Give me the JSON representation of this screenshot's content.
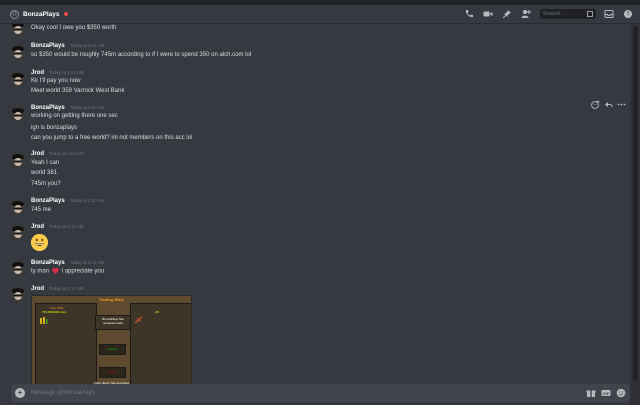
{
  "header": {
    "at_symbol": "@",
    "channel_name": "BonzaPlays",
    "search_placeholder": "Search"
  },
  "messages": [
    {
      "author": "",
      "time": "",
      "lines": [
        "Okay cool I owe you $350 worth"
      ]
    },
    {
      "author": "BonzaPlays",
      "time": "Today at 2:01 AM",
      "lines": [
        "so $350 would be roughly 745m according to if I were to spend 350 on alch.com lol"
      ]
    },
    {
      "author": "Jrod",
      "time": "Today at 2:02 AM",
      "lines": [
        "Kk I'll pay you now",
        "Meet world 359 Varrock West Bank"
      ]
    },
    {
      "author": "BonzaPlays",
      "time": "Today at 2:03 AM",
      "lines": [
        "working on getting there one sec",
        "ign is bonzaplays",
        "can you jump to a free world? im not members on this acc lol"
      ]
    },
    {
      "author": "Jrod",
      "time": "Today at 2:04 AM",
      "lines": [
        "Yeah I can",
        "world 381",
        "745m you?"
      ]
    },
    {
      "author": "BonzaPlays",
      "time": "Today at 2:10 AM",
      "lines": [
        "745 me"
      ]
    },
    {
      "author": "Jrod",
      "time": "Today at 2:11 AM",
      "emoji": "grinning-face"
    },
    {
      "author": "BonzaPlays",
      "time": "Today at 2:11 AM",
      "line_before_heart": "ty man",
      "line_after_heart": "I appreciate you"
    },
    {
      "author": "Jrod",
      "time": "Today at 2:11 AM",
      "image": "trade-screenshot"
    }
  ],
  "trade_image": {
    "title": "Trading With:",
    "left_label": "Your Offer",
    "left_value": "745,000,000 coins",
    "right_value": "2/0",
    "status": "BonzaPlays has accepted trade",
    "accept": "Accept",
    "decline": "Decline",
    "footer": "Other player has accepted."
  },
  "composer": {
    "placeholder": "Message @BonzaPlays",
    "plus": "+"
  },
  "colors": {
    "background": "#36393f",
    "sidebar": "#2f3136",
    "text": "#dcddde",
    "muted": "#72767d",
    "dnd_status": "#f04747",
    "emoji": "#ffcc4d",
    "heart": "#dd2e44"
  }
}
